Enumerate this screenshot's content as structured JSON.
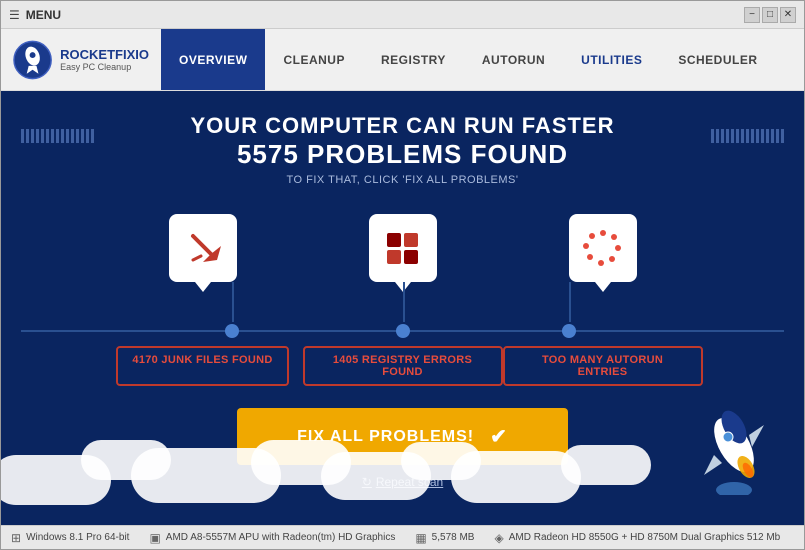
{
  "window": {
    "title": "MENU",
    "minimize_label": "−",
    "maximize_label": "□",
    "close_label": "✕"
  },
  "logo": {
    "title": "ROCKETFIXIO",
    "subtitle": "Easy PC Cleanup"
  },
  "nav": {
    "items": [
      {
        "id": "overview",
        "label": "OVERVIEW",
        "active": true
      },
      {
        "id": "cleanup",
        "label": "CLEANUP",
        "active": false
      },
      {
        "id": "registry",
        "label": "REGISTRY",
        "active": false
      },
      {
        "id": "autorun",
        "label": "AUTORUN",
        "active": false
      },
      {
        "id": "utilities",
        "label": "UTILITIES",
        "active": false,
        "highlighted": true
      },
      {
        "id": "scheduler",
        "label": "SCHEDULER",
        "active": false
      }
    ]
  },
  "hero": {
    "line1": "YOUR COMPUTER CAN RUN FASTER",
    "line2": "5575 PROBLEMS FOUND",
    "line3": "TO FIX THAT, CLICK 'FIX ALL PROBLEMS'"
  },
  "features": [
    {
      "id": "junk",
      "label": "4170 JUNK FILES FOUND"
    },
    {
      "id": "registry",
      "label": "1405 REGISTRY ERRORS FOUND"
    },
    {
      "id": "autorun",
      "label": "TOO MANY AUTORUN ENTRIES"
    }
  ],
  "fix_button": {
    "label": "FIX ALL PROBLEMS!"
  },
  "repeat_scan": {
    "label": "Repeat scan"
  },
  "status_bar": {
    "items": [
      {
        "icon": "windows-icon",
        "text": "Windows 8.1 Pro 64-bit"
      },
      {
        "icon": "cpu-icon",
        "text": "AMD A8-5557M APU with Radeon(tm) HD Graphics"
      },
      {
        "icon": "memory-icon",
        "text": "5,578 MB"
      },
      {
        "icon": "gpu-icon",
        "text": "AMD Radeon HD 8550G + HD 8750M Dual Graphics 512 Mb"
      }
    ]
  }
}
